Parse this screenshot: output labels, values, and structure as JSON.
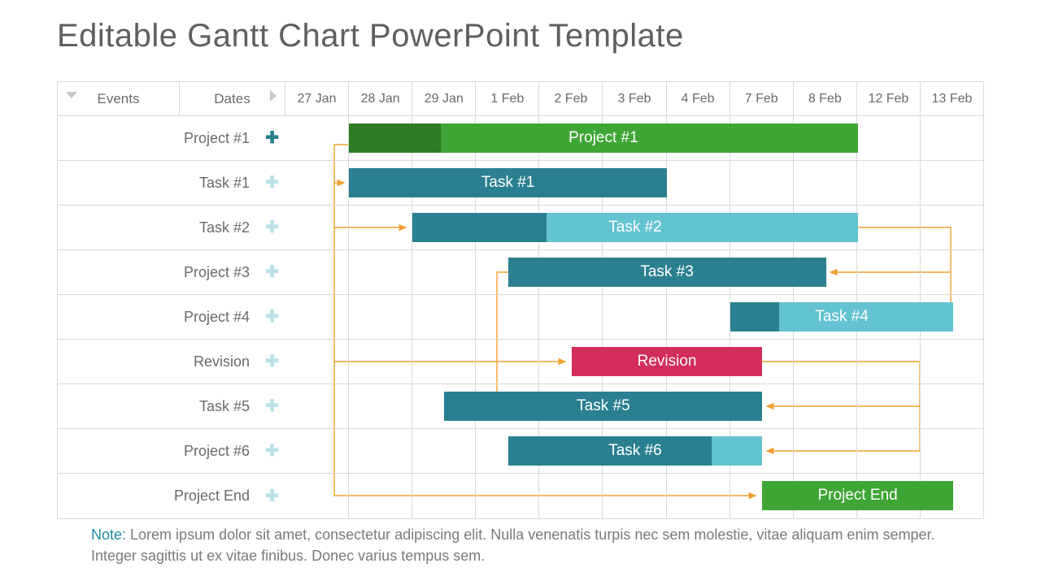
{
  "title": "Editable Gantt Chart PowerPoint Template",
  "header": {
    "events_label": "Events",
    "dates_label": "Dates",
    "timeline": [
      "27 Jan",
      "28 Jan",
      "29 Jan",
      "1 Feb",
      "2 Feb",
      "3 Feb",
      "4 Feb",
      "7 Feb",
      "8 Feb",
      "12 Feb",
      "13 Feb"
    ]
  },
  "rows": [
    {
      "label": "Project #1",
      "plus": "teal",
      "bar_label": "Project #1",
      "start": 1,
      "span": 8,
      "color": "#3fa535",
      "progress_color": "#2e7d24",
      "progress": 0.18
    },
    {
      "label": "Task #1",
      "plus": "light",
      "bar_label": "Task #1",
      "start": 1,
      "span": 5,
      "color": "#2a8090"
    },
    {
      "label": "Task #2",
      "plus": "light",
      "bar_label": "Task #2",
      "start": 2,
      "span": 7,
      "color": "#63c3d1",
      "progress_color": "#2a8090",
      "progress": 0.3
    },
    {
      "label": "Project #3",
      "plus": "light",
      "bar_label": "Task #3",
      "start": 3.5,
      "span": 5,
      "color": "#2a8090"
    },
    {
      "label": "Project #4",
      "plus": "light",
      "bar_label": "Task #4",
      "start": 7,
      "span": 3.5,
      "color": "#63c3d1",
      "progress_color": "#2a8090",
      "progress": 0.22
    },
    {
      "label": "Revision",
      "plus": "light",
      "bar_label": "Revision",
      "start": 4.5,
      "span": 3,
      "color": "#d32d5c"
    },
    {
      "label": "Task #5",
      "plus": "light",
      "bar_label": "Task #5",
      "start": 2.5,
      "span": 5,
      "color": "#2a8090"
    },
    {
      "label": "Project #6",
      "plus": "light",
      "bar_label": "Task #6",
      "start": 3.5,
      "span": 4,
      "color": "#2a8090",
      "secondary_color": "#63c3d1",
      "secondary": 0.2
    },
    {
      "label": "Project End",
      "plus": "light",
      "bar_label": "Project End",
      "start": 7.5,
      "span": 3,
      "color": "#3fa535"
    }
  ],
  "chart_data": {
    "type": "bar",
    "orientation": "horizontal-gantt",
    "x_categories": [
      "27 Jan",
      "28 Jan",
      "29 Jan",
      "1 Feb",
      "2 Feb",
      "3 Feb",
      "4 Feb",
      "7 Feb",
      "8 Feb",
      "12 Feb",
      "13 Feb"
    ],
    "tasks": [
      {
        "name": "Project #1",
        "start": "28 Jan",
        "end": "8 Feb",
        "color": "green",
        "progress": 0.18
      },
      {
        "name": "Task #1",
        "start": "28 Jan",
        "end": "3 Feb",
        "color": "teal"
      },
      {
        "name": "Task #2",
        "start": "29 Jan",
        "end": "8 Feb",
        "color": "teal-light",
        "progress": 0.3
      },
      {
        "name": "Task #3",
        "start": "1 Feb",
        "end": "8 Feb",
        "color": "teal"
      },
      {
        "name": "Task #4",
        "start": "7 Feb",
        "end": "13 Feb",
        "color": "teal-light",
        "progress": 0.22
      },
      {
        "name": "Revision",
        "start": "2 Feb",
        "end": "7 Feb",
        "color": "magenta"
      },
      {
        "name": "Task #5",
        "start": "29 Jan",
        "end": "7 Feb",
        "color": "teal"
      },
      {
        "name": "Task #6",
        "start": "1 Feb",
        "end": "7 Feb",
        "color": "teal"
      },
      {
        "name": "Project End",
        "start": "7 Feb",
        "end": "13 Feb",
        "color": "green"
      }
    ],
    "dependencies": [
      [
        "Project #1",
        "Task #1"
      ],
      [
        "Project #1",
        "Task #2"
      ],
      [
        "Project #1",
        "Revision"
      ],
      [
        "Project #1",
        "Project End"
      ],
      [
        "Task #2",
        "Task #3"
      ],
      [
        "Task #2",
        "Task #4"
      ],
      [
        "Task #3",
        "Task #5"
      ],
      [
        "Task #3",
        "Task #6"
      ],
      [
        "Revision",
        "Task #5"
      ],
      [
        "Revision",
        "Task #6"
      ]
    ],
    "xlabel": "",
    "ylabel": ""
  },
  "note": {
    "label": "Note:",
    "text": " Lorem ipsum dolor sit amet, consectetur adipiscing elit. Nulla venenatis turpis nec sem molestie, vitae aliquam enim semper. Integer sagittis ut ex vitae finibus. Donec varius tempus sem."
  }
}
